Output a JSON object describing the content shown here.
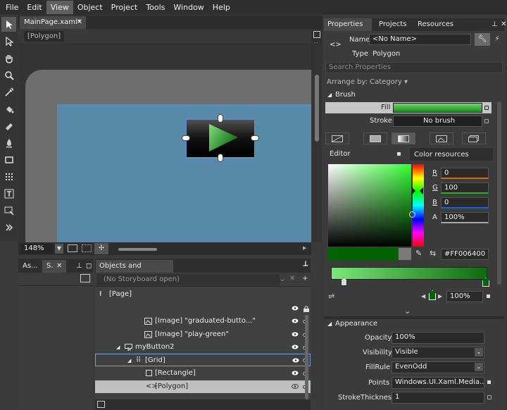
{
  "menu": [
    "File",
    "Edit",
    "View",
    "Object",
    "Project",
    "Tools",
    "Window",
    "Help"
  ],
  "document": {
    "tab_title": "MainPage.xaml*",
    "breadcrumb": "[Polygon]"
  },
  "canvas": {
    "zoom": "148%"
  },
  "left_tabs": {
    "assets": "As...",
    "states": "S."
  },
  "objects": {
    "title": "Objects and Timeline",
    "storyboard": "(No Storyboard open)",
    "tree": [
      {
        "label": "[Page]"
      },
      {
        "label": "[Image] \"graduated-butto...\""
      },
      {
        "label": "[Image] \"play-green\""
      },
      {
        "label": "myButton2"
      },
      {
        "label": "[Grid]"
      },
      {
        "label": "[Rectangle]"
      },
      {
        "label": "[Polygon]"
      }
    ]
  },
  "properties": {
    "tabs": [
      "Properties",
      "Projects",
      "Resources"
    ],
    "name_label": "Name",
    "name_value": "<No Name>",
    "type_label": "Type",
    "type_value": "Polygon",
    "search_placeholder": "Search Properties",
    "arrange_by": "Arrange by: Category",
    "brush": {
      "title": "Brush",
      "fill_label": "Fill",
      "stroke_label": "Stroke",
      "stroke_value": "No brush",
      "editor_tab": "Editor",
      "color_resources_tab": "Color resources",
      "r_label": "R",
      "r_value": "0",
      "g_label": "G",
      "g_value": "100",
      "b_label": "B",
      "b_value": "0",
      "a_label": "A",
      "a_value": "100%",
      "hex": "#FF006400",
      "stop_offset": "100%"
    },
    "appearance": {
      "title": "Appearance",
      "opacity_label": "Opacity",
      "opacity_value": "100%",
      "visibility_label": "Visibility",
      "visibility_value": "Visible",
      "fillrule_label": "FillRule",
      "fillrule_value": "EvenOdd",
      "points_label": "Points",
      "points_value": "Windows.UI.Xaml.Media....",
      "strokethickness_label": "StrokeThickness",
      "strokethickness_value": "1"
    }
  },
  "colors": {
    "fill_green": "#2ea02e",
    "selected_green": "#006400",
    "accent_blue": "#4a7ab4"
  },
  "icons": [
    "selection-icon",
    "direct-select-icon",
    "pan-icon",
    "zoom-icon",
    "eyedropper-icon",
    "paint-bucket-icon",
    "gradient-icon",
    "brush-icon",
    "rectangle-icon",
    "grid-icon",
    "text-icon",
    "shape-icon",
    "more-tools-icon"
  ]
}
